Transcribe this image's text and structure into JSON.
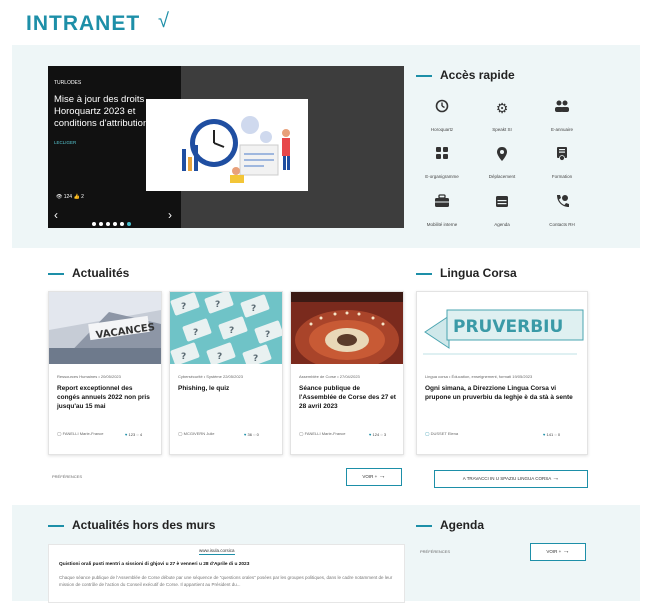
{
  "header": {
    "logo": "INTRANET",
    "logo_mark": "√"
  },
  "carousel": {
    "tag": "TURLODES",
    "title": "Mise à jour des droits Horoquartz 2023 et conditions d'attribution de...",
    "link": "LECLIGER",
    "stats": "124",
    "stats2": "2",
    "prev": "‹",
    "next": "›"
  },
  "quick_access": {
    "title": "Accès rapide",
    "items": [
      {
        "label": "Horoquartz",
        "icon": "clock-icon"
      },
      {
        "label": "Speakt SI",
        "icon": "gear-icon"
      },
      {
        "label": "E-annuaire",
        "icon": "people-icon"
      },
      {
        "label": "E-organigramme",
        "icon": "grid-icon"
      },
      {
        "label": "Déplacement",
        "icon": "location-icon"
      },
      {
        "label": "Formation",
        "icon": "certificate-icon"
      },
      {
        "label": "Mobilité interne",
        "icon": "briefcase-icon"
      },
      {
        "label": "Agenda",
        "icon": "calendar-icon"
      },
      {
        "label": "Contacts RH",
        "icon": "phone-icon"
      }
    ]
  },
  "news": {
    "title": "Actualités",
    "cards": [
      {
        "meta": "Ressources Humaines  •  20/05/2023",
        "title": "Report exceptionnel des congés annuels 2022 non pris jusqu'au 15 mai",
        "author": "FANELLI Marie-France",
        "likes": "123",
        "comments": "4"
      },
      {
        "meta": "Cybersécurité  •  Système  22/05/2023",
        "title": "Phishing, le quiz",
        "author": "MCGIVERN Julie",
        "likes": "36",
        "comments": "0"
      },
      {
        "meta": "Assemblée de Corse  •  27/04/2023",
        "title": "Séance publique de l'Assemblée de Corse des 27 et 28 avril 2023",
        "author": "FANELLI Marie-France",
        "likes": "124",
        "comments": "3"
      }
    ],
    "preferences": "PRÉFÉRENCES",
    "see_button": "VOIR +"
  },
  "lingua": {
    "title": "Lingua Corsa",
    "banner": "PRUVERBIU",
    "meta": "Lingua corsa  •  Éducation, enseignement, formati  19/05/2023",
    "card_title": "Ogni simana, a Direzzione Lingua Corsa vi prupone un pruverbiu da leghje è da stà à sente",
    "author": "DUSSET Elena",
    "likes": "141",
    "comments": "0",
    "button": "A TRAVACCI IN U SPAZIU LINGUA CORSA"
  },
  "outside": {
    "title": "Actualités hors des murs",
    "source": "www.isula.corsica",
    "headline": "Quistioni orali pusti mentri a sissioni di ghjovi u 27 è venneri u 28 d'Aprile di u 2023",
    "body": "Chaque séance publique de l'Assemblée de Corse débute par une séquence de \"questions orales\" posées par les groupes politiques, dans le cadre notamment de leur mission de contrôle de l'action du Conseil exécutif de Corse. Il appartient au Président du..."
  },
  "agenda": {
    "title": "Agenda",
    "preferences": "PRÉFÉRENCES",
    "see_button": "VOIR +"
  },
  "colors": {
    "accent": "#1d8fa8",
    "band": "#eef6f7"
  }
}
